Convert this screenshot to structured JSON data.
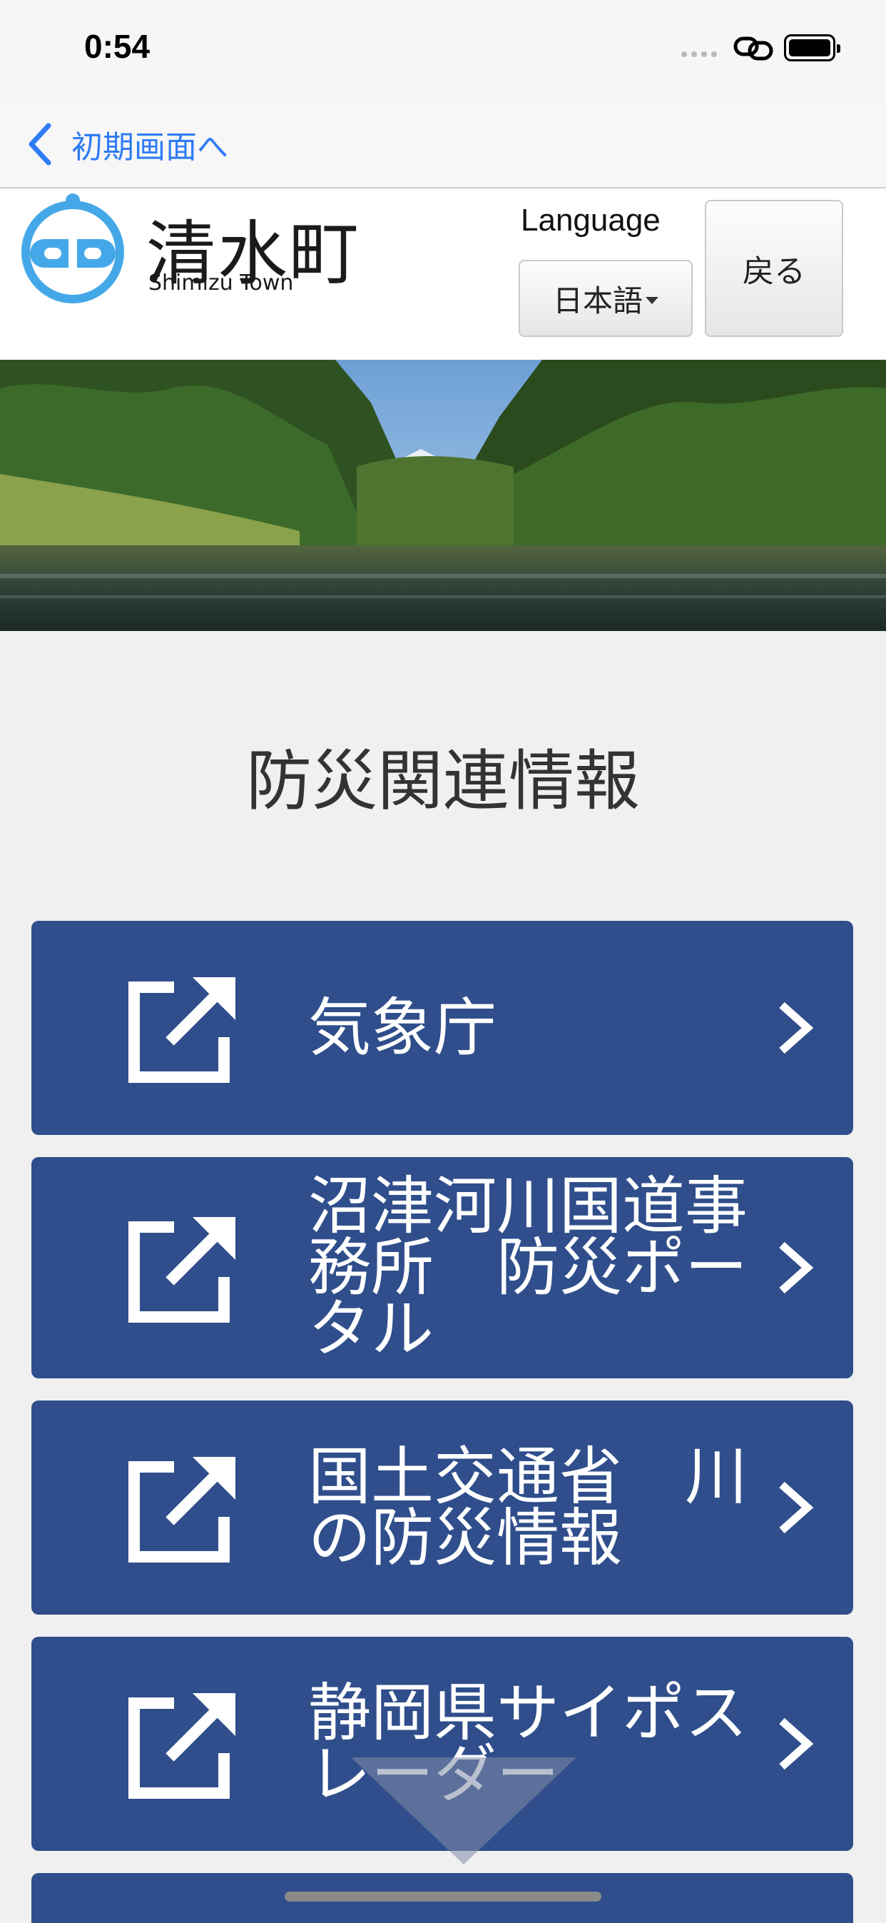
{
  "status_bar": {
    "time": "0:54"
  },
  "nav": {
    "back_label": "初期画面へ"
  },
  "header": {
    "logo_name": "清水町",
    "logo_sub": "Shimizu Town",
    "language_label": "Language",
    "language_selected": "日本語",
    "back_button": "戻る"
  },
  "page": {
    "title": "防災関連情報"
  },
  "links": [
    {
      "label": "気象庁"
    },
    {
      "label": "沼津河川国道事務所　防災ポータル"
    },
    {
      "label": "国土交通省　川の防災情報"
    },
    {
      "label": "静岡県サイポスレーダー"
    }
  ],
  "colors": {
    "card": "#2f4e8b",
    "accent": "#2f7cf6",
    "background": "#f0f0f0"
  }
}
